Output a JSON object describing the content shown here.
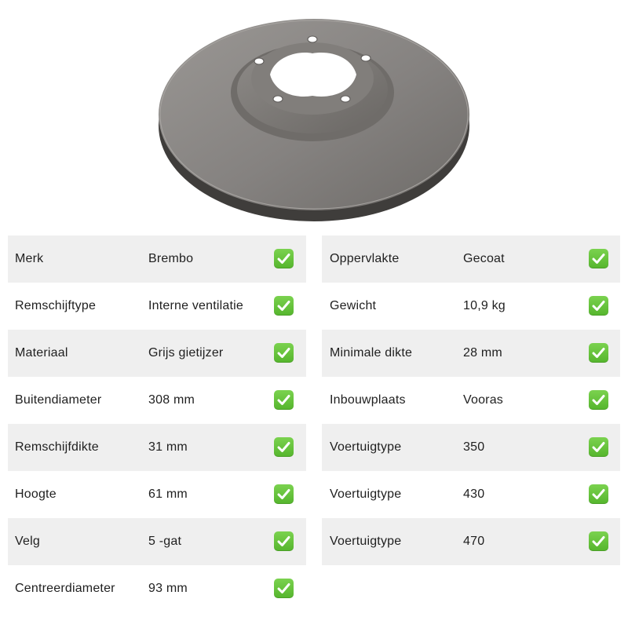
{
  "product_image": {
    "subject": "brake-disc",
    "colors": {
      "face": "#8a8784",
      "rim": "#5f5c59",
      "hub": "#7a7774",
      "shadow": "#3a3836"
    }
  },
  "check_icon": {
    "name": "check-mark-icon",
    "color": "#5cbc33"
  },
  "specs_left": [
    {
      "label": "Merk",
      "value": "Brembo",
      "checked": true
    },
    {
      "label": "Remschijftype",
      "value": "Interne ventilatie",
      "checked": true
    },
    {
      "label": "Materiaal",
      "value": "Grijs gietijzer",
      "checked": true
    },
    {
      "label": "Buitendiameter",
      "value": "308 mm",
      "checked": true
    },
    {
      "label": "Remschijfdikte",
      "value": "31 mm",
      "checked": true
    },
    {
      "label": "Hoogte",
      "value": "61 mm",
      "checked": true
    },
    {
      "label": "Velg",
      "value": "5 -gat",
      "checked": true
    },
    {
      "label": "Centreerdiameter",
      "value": "93 mm",
      "checked": true
    }
  ],
  "specs_right": [
    {
      "label": "Oppervlakte",
      "value": "Gecoat",
      "checked": true
    },
    {
      "label": "Gewicht",
      "value": "10,9 kg",
      "checked": true
    },
    {
      "label": "Minimale dikte",
      "value": "28 mm",
      "checked": true
    },
    {
      "label": "Inbouwplaats",
      "value": "Vooras",
      "checked": true
    },
    {
      "label": "Voertuigtype",
      "value": "350",
      "checked": true
    },
    {
      "label": "Voertuigtype",
      "value": "430",
      "checked": true
    },
    {
      "label": "Voertuigtype",
      "value": "470",
      "checked": true
    }
  ]
}
